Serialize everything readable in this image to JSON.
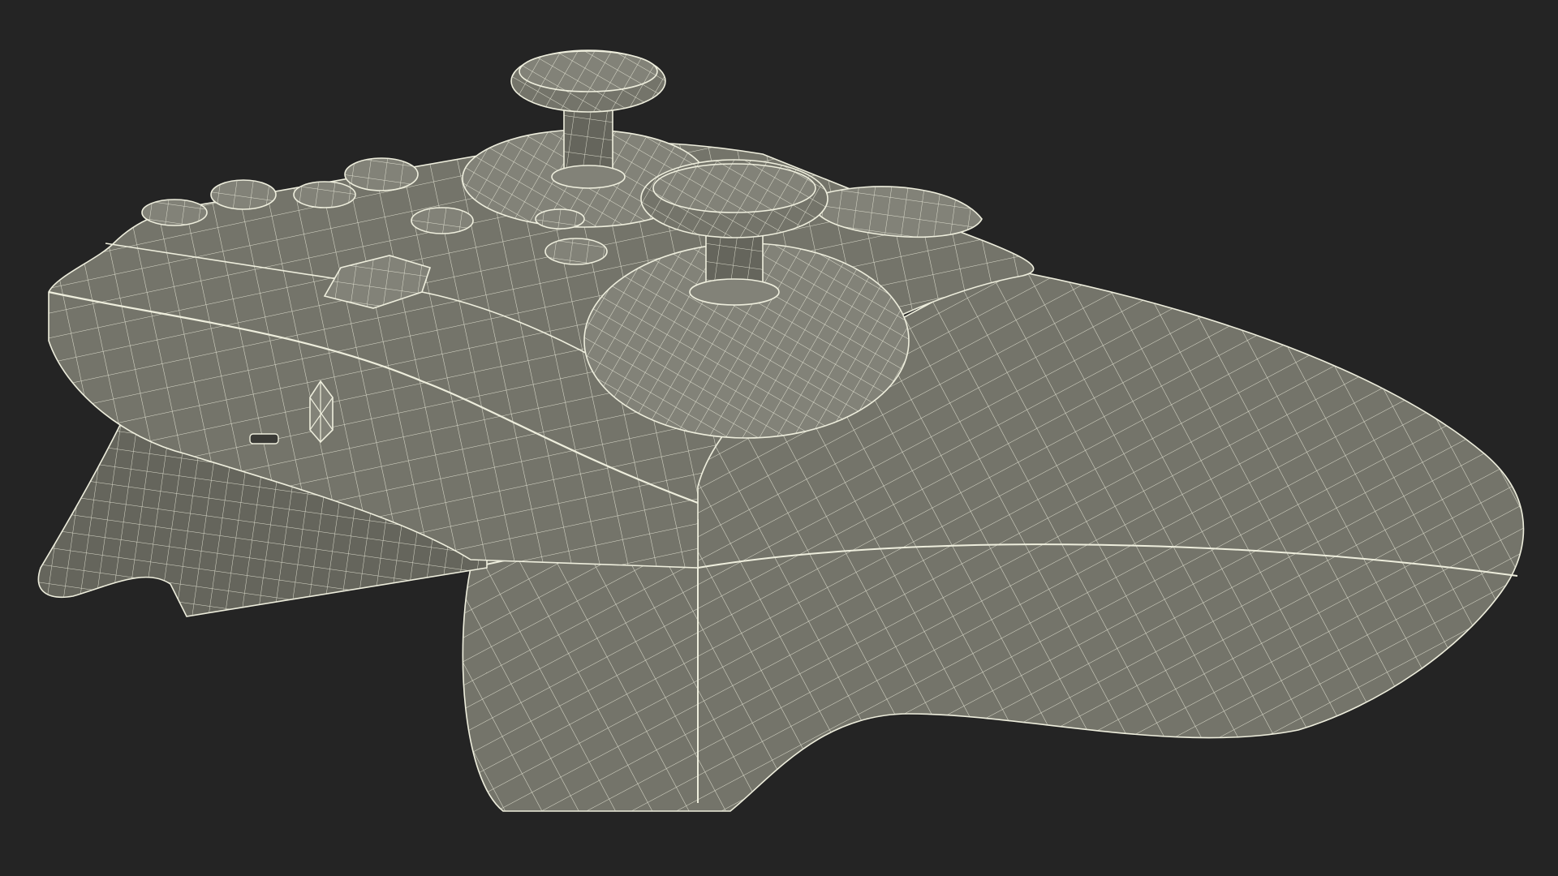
{
  "scene": {
    "subject": "game-controller",
    "render_style": "wireframe",
    "colors": {
      "background": "#242424",
      "surface": "#74746a",
      "surface_dark": "#65655c",
      "surface_light": "#828278",
      "wire": "#eeeedd"
    },
    "parts": [
      "controller-body-shell",
      "right-grip",
      "left-grip",
      "left-thumbstick",
      "right-thumbstick",
      "right-bumper",
      "d-pad",
      "face-buttons",
      "guide-button",
      "usb-port"
    ]
  }
}
